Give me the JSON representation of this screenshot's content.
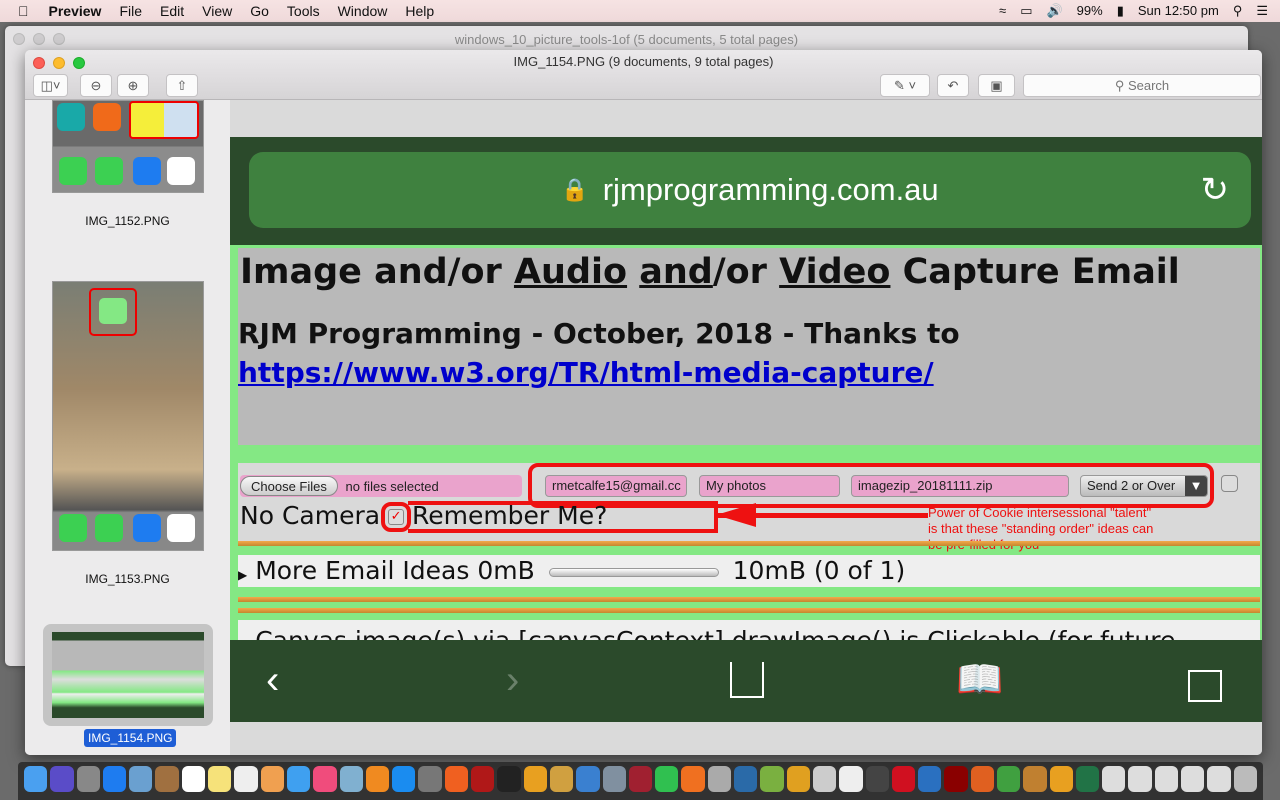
{
  "menubar": {
    "app": "Preview",
    "items": [
      "File",
      "Edit",
      "View",
      "Go",
      "Tools",
      "Window",
      "Help"
    ],
    "battery": "99%",
    "clock": "Sun 12:50 pm"
  },
  "background_window": {
    "title": "windows_10_picture_tools-1of (5 documents, 5 total pages)"
  },
  "window": {
    "title": "IMG_1154.PNG (9 documents, 9 total pages)",
    "search_placeholder": "Search"
  },
  "sidebar": {
    "items": [
      {
        "label": "IMG_1152.PNG",
        "selected": false
      },
      {
        "label": "IMG_1153.PNG",
        "selected": false
      },
      {
        "label": "IMG_1154.PNG",
        "selected": true
      }
    ]
  },
  "safari": {
    "url": "rjmprogramming.com.au"
  },
  "page": {
    "h1_parts": [
      "Image and/or ",
      "Audio",
      " ",
      "and",
      "/or ",
      "Video",
      " Capture Email"
    ],
    "h2_text": "RJM Programming - October, 2018 - Thanks to",
    "h2_link": "https://www.w3.org/TR/html-media-capture/",
    "choose_files": "Choose Files",
    "no_files": "no files selected",
    "email_value": "rmetcalfe15@gmail.cc",
    "subject_value": "My photos",
    "zip_value": "imagezip_20181111.zip",
    "send_select": "Send 2 or Over",
    "no_camera": "No Camera",
    "remember_me": "Remember Me?",
    "remember_checked": true,
    "annotation": [
      "Power of Cookie intersessional \"talent\"",
      "is that these \"standing order\" ideas can",
      "be pre-filled for you"
    ],
    "details_label": "More Email Ideas  0mB",
    "progress_value": 0,
    "progress_max_label": "10mB (0 of 1)",
    "canvas_label": "Canvas image(s) via [canvasContext].drawImage() is Clickable (for future"
  },
  "colors": {
    "accent_red": "#ee1111",
    "safari_green": "#2b4a2b",
    "page_green": "#84e884",
    "pink_field": "#eaa3cc"
  },
  "dock": {
    "icons": [
      "finder",
      "siri",
      "launchpad",
      "safari",
      "mail",
      "notes-book",
      "calendar",
      "notes",
      "reminders",
      "photos",
      "messages",
      "itunes",
      "preview",
      "ibooks",
      "app-store",
      "system-preferences",
      "firefox",
      "filezilla",
      "terminal",
      "xampp",
      "textedit",
      "xcode",
      "image-capture",
      "photo-booth",
      "facetime",
      "avast",
      "grapher",
      "netbeans",
      "android-studio",
      "android",
      "inkscape",
      "file",
      "quicktime",
      "opera",
      "vscode",
      "acrobat",
      "gimp",
      "chrome",
      "textwrangler",
      "xampp2",
      "excel",
      "window1",
      "window2",
      "window3",
      "window4",
      "window5",
      "trash"
    ]
  }
}
